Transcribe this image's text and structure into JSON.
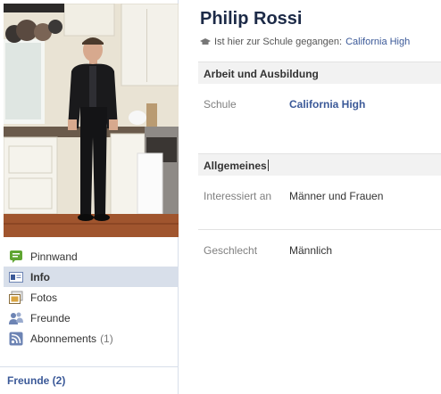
{
  "profile": {
    "name": "Philip Rossi",
    "school_prefix": "Ist hier zur Schule gegangen:",
    "school_link": "California High"
  },
  "sidebar": {
    "items": [
      {
        "label": "Pinnwand",
        "icon": "wall-icon",
        "active": false
      },
      {
        "label": "Info",
        "icon": "info-icon",
        "active": true
      },
      {
        "label": "Fotos",
        "icon": "photos-icon",
        "active": false
      },
      {
        "label": "Freunde",
        "icon": "friends-icon",
        "active": false
      },
      {
        "label": "Abonnements",
        "icon": "rss-icon",
        "count": "(1)",
        "active": false
      }
    ],
    "friends_link": "Freunde (2)"
  },
  "sections": {
    "work_education": {
      "title": "Arbeit und Ausbildung",
      "school_label": "Schule",
      "school_value": "California High"
    },
    "general": {
      "title": "Allgemeines",
      "interested_label": "Interessiert an",
      "interested_value": "Männer und Frauen",
      "gender_label": "Geschlecht",
      "gender_value": "Männlich"
    }
  },
  "colors": {
    "link": "#3b5998",
    "name": "#1c2a47",
    "active_nav": "#d8dfea",
    "section_bg": "#f2f2f2"
  }
}
